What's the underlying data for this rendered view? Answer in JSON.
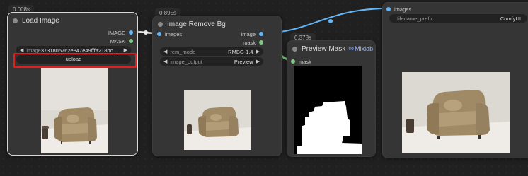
{
  "colors": {
    "image_link": "#64b5f6",
    "mask_link": "#81c784",
    "highlight": "#e02020"
  },
  "load_image": {
    "timing": "0.008s",
    "title": "Load Image",
    "outputs": [
      "IMAGE",
      "MASK"
    ],
    "image_widget": {
      "label": "image",
      "value": "3731805762e847e49fffa218bc56..."
    },
    "upload_label": "upload"
  },
  "remove_bg": {
    "timing": "0.895s",
    "title": "Image Remove Bg",
    "input": "images",
    "outputs": [
      "image",
      "mask"
    ],
    "rem_mode": {
      "label": "rem_mode",
      "value": "RMBG-1.4"
    },
    "image_output": {
      "label": "image_output",
      "value": "Preview"
    }
  },
  "preview_mask": {
    "timing": "0.378s",
    "title": "Preview Mask",
    "badge": "Mixlab",
    "badge_icon": "infinity-icon",
    "input": "mask"
  },
  "save_image": {
    "input": "images",
    "filename_prefix": {
      "label": "filename_prefix",
      "value": "ComfyUI"
    }
  }
}
